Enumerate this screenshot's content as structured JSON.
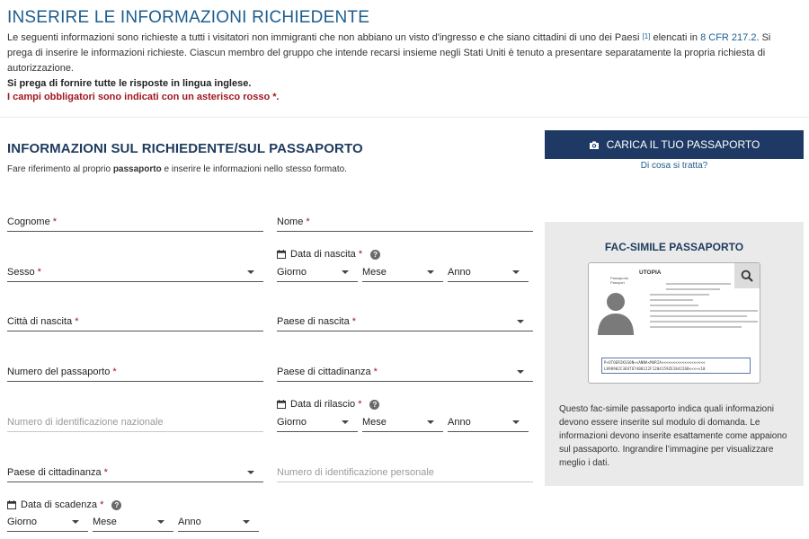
{
  "header": {
    "title": "INSERIRE LE INFORMAZIONI RICHIEDENTE",
    "intro_part1": "Le seguenti informazioni sono richieste a tutti i visitatori non immigranti che non abbiano un visto d'ingresso e che siano cittadini di uno dei Paesi",
    "intro_sup": "[1]",
    "intro_part2": " elencati in ",
    "intro_link": "8 CFR 217.2",
    "intro_part3": ". Si prega di inserire le informazioni richieste. Ciascun membro del gruppo che intende recarsi insieme negli Stati Uniti è tenuto a presentare separatamente la propria richiesta di autorizzazione.",
    "note_english": "Si prega di fornire tutte le risposte in lingua inglese.",
    "note_required": "I campi obbligatori sono indicati con un asterisco rosso *."
  },
  "section": {
    "title": "INFORMAZIONI SUL RICHIEDENTE/SUL PASSAPORTO",
    "subtitle_pre": "Fare riferimento al proprio ",
    "subtitle_bold": "passaporto",
    "subtitle_post": " e inserire le informazioni nello stesso formato."
  },
  "upload": {
    "button_label": "CARICA IL TUO PASSAPORTO",
    "help_link": "Di cosa si tratta?"
  },
  "fields": {
    "surname": "Cognome",
    "name": "Nome",
    "sex": "Sesso",
    "birth_date": "Data di nascita",
    "birth_city": "Città di nascita",
    "birth_country": "Paese di nascita",
    "passport_number": "Numero del passaporto",
    "citizenship_country": "Paese di cittadinanza",
    "national_id_placeholder": "Numero di identificazione nazionale",
    "issue_date": "Data di rilascio",
    "citizenship_country_2": "Paese di cittadinanza",
    "personal_id_placeholder": "Numero di identificazione personale",
    "expiry_date": "Data di scadenza",
    "required_mark": "*",
    "day": "Giorno",
    "month": "Mese",
    "year": "Anno",
    "help_mark": "?"
  },
  "sample": {
    "title": "FAC-SIMILE PASSAPORTO",
    "country": "UTOPIA",
    "passport_word": "Passaporto\nPassport",
    "mrz_line1": "P<UTOERIKSSON<<ANNA<MARIA<<<<<<<<<<<<<<<<<<<",
    "mrz_line2": "L898902C36UTO7408122F1204159ZE184226B<<<<<10",
    "description": "Questo fac-simile passaporto indica quali informazioni devono essere inserite sul modulo di domanda. Le informazioni devono inserite esattamente come appaiono sul passaporto. Ingrandire l’immagine per visualizzare meglio i dati."
  },
  "colors": {
    "title_blue": "#1d5d8e",
    "navy": "#1e3a64",
    "required_red": "#a0171e",
    "panel_bg": "#eaeaea"
  }
}
